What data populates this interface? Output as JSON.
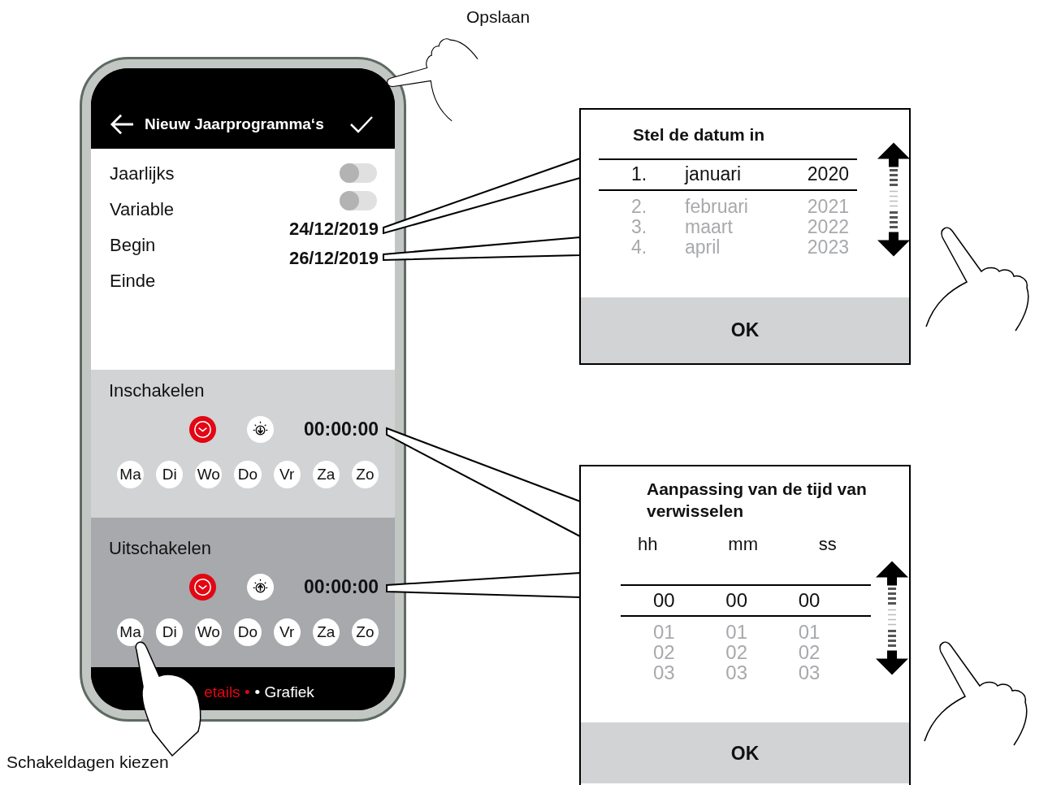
{
  "annotations": {
    "save_label": "Opslaan",
    "days_label": "Schakeldagen kiezen"
  },
  "phone": {
    "title": "Nieuw Jaarprogramma‘s",
    "settings": [
      {
        "label": "Jaarlijks"
      },
      {
        "label": "Variable"
      },
      {
        "label": "Begin"
      },
      {
        "label": "Einde"
      }
    ],
    "toggles": [
      {
        "on": false
      },
      {
        "on": false
      }
    ],
    "dates": [
      "24/12/2019",
      "26/12/2019"
    ],
    "sections": [
      {
        "title": "Inschakelen",
        "kind": "on",
        "modes": [
          {
            "kind": "clock",
            "selected": true
          },
          {
            "kind": "sun-down",
            "selected": false
          }
        ],
        "time": "00:00:00",
        "days": [
          "Ma",
          "Di",
          "Wo",
          "Do",
          "Vr",
          "Za",
          "Zo"
        ]
      },
      {
        "title": "Uitschakelen",
        "kind": "off",
        "modes": [
          {
            "kind": "clock",
            "selected": true
          },
          {
            "kind": "sun-up",
            "selected": false
          }
        ],
        "time": "00:00:00",
        "days": [
          "Ma",
          "Di",
          "Wo",
          "Do",
          "Vr",
          "Za",
          "Zo"
        ]
      }
    ],
    "footer_tabs": [
      {
        "label": "etails •",
        "selected": true
      },
      {
        "label": "• Grafiek",
        "selected": false
      }
    ]
  },
  "date_dialog": {
    "title": "Stel de datum in",
    "rows": [
      {
        "day": "1.",
        "month": "januari",
        "year": "2020",
        "selected": true
      },
      {
        "day": "2.",
        "month": "februari",
        "year": "2021",
        "selected": false
      },
      {
        "day": "3.",
        "month": "maart",
        "year": "2022",
        "selected": false
      },
      {
        "day": "4.",
        "month": "april",
        "year": "2023",
        "selected": false
      }
    ],
    "ok": "OK"
  },
  "time_dialog": {
    "title": "Aanpassing van de tijd van verwisselen",
    "headers": [
      "hh",
      "mm",
      "ss"
    ],
    "rows": [
      {
        "values": [
          "00",
          "00",
          "00"
        ],
        "selected": true
      },
      {
        "values": [
          "01",
          "01",
          "01"
        ],
        "selected": false
      },
      {
        "values": [
          "02",
          "02",
          "02"
        ],
        "selected": false
      },
      {
        "values": [
          "03",
          "03",
          "03"
        ],
        "selected": false
      }
    ],
    "ok": "OK"
  }
}
